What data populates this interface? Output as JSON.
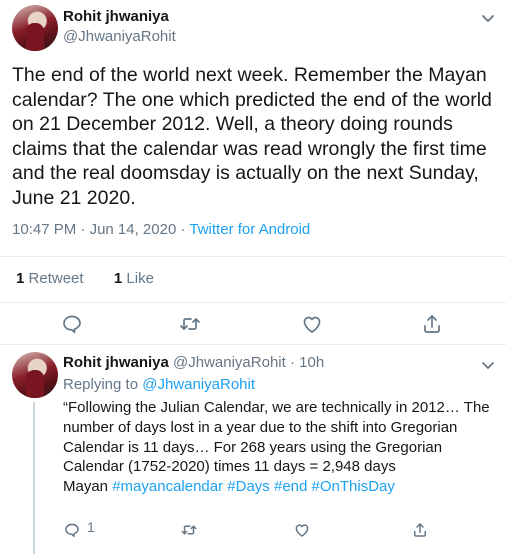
{
  "tweet": {
    "author_name": "Rohit jhwaniya",
    "author_handle": "@JhwaniyaRohit",
    "text": "The end of the world next week.  Remember the Mayan calendar? The one which predicted the end of the world on 21 December 2012. Well, a theory doing rounds claims that the calendar was read wrongly the first time and the real doomsday is actually on the next Sunday, June 21 2020.",
    "time": "10:47 PM",
    "separator": "·",
    "date": "Jun 14, 2020",
    "source": "Twitter for Android",
    "retweet_count": "1",
    "retweet_label": "Retweet",
    "like_count": "1",
    "like_label": "Like"
  },
  "reply": {
    "author_name": "Rohit jhwaniya",
    "author_handle": "@JhwaniyaRohit",
    "separator": "·",
    "age": "10h",
    "replying_label": "Replying to",
    "replying_to": "@JhwaniyaRohit",
    "text_main": "“Following the Julian Calendar, we are technically in 2012… The number of days lost in a year due to the shift into Gregorian Calendar is 11 days… For 268 years using the Gregorian Calendar (1752-2020) times 11 days = 2,948 days",
    "text_prefix": "Mayan",
    "hashtags": [
      "#mayancalendar",
      "#Days",
      "#end",
      "#OnThisDay"
    ],
    "reply_count": "1"
  },
  "colors": {
    "text": "#14171a",
    "secondary": "#657786",
    "link": "#1da1f2",
    "divider": "#e6ecf0"
  },
  "icons": [
    "chevron-down-icon",
    "reply-icon",
    "retweet-icon",
    "like-icon",
    "share-icon"
  ]
}
